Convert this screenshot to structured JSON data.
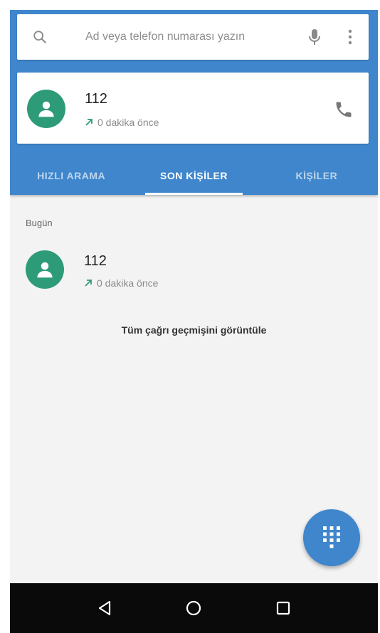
{
  "search": {
    "placeholder": "Ad veya telefon numarası yazın"
  },
  "top_contact": {
    "name": "112",
    "time": "0 dakika önce"
  },
  "tabs": [
    {
      "label": "HIZLI ARAMA",
      "active": false
    },
    {
      "label": "SON KİŞİLER",
      "active": true
    },
    {
      "label": "KİŞİLER",
      "active": false
    }
  ],
  "recent": {
    "section_label": "Bugün",
    "items": [
      {
        "name": "112",
        "time": "0 dakika önce"
      }
    ],
    "view_all": "Tüm çağrı geçmişini görüntüle"
  },
  "colors": {
    "primary": "#3f86cc",
    "avatar": "#2e9b78",
    "outgoing_arrow": "#2e9b78",
    "navbar": "#0a0a0a"
  },
  "icons": [
    "search-icon",
    "mic-icon",
    "more-vert-icon",
    "person-icon",
    "phone-icon",
    "outgoing-call-icon",
    "dialpad-icon",
    "back-icon",
    "home-icon",
    "recents-icon"
  ]
}
